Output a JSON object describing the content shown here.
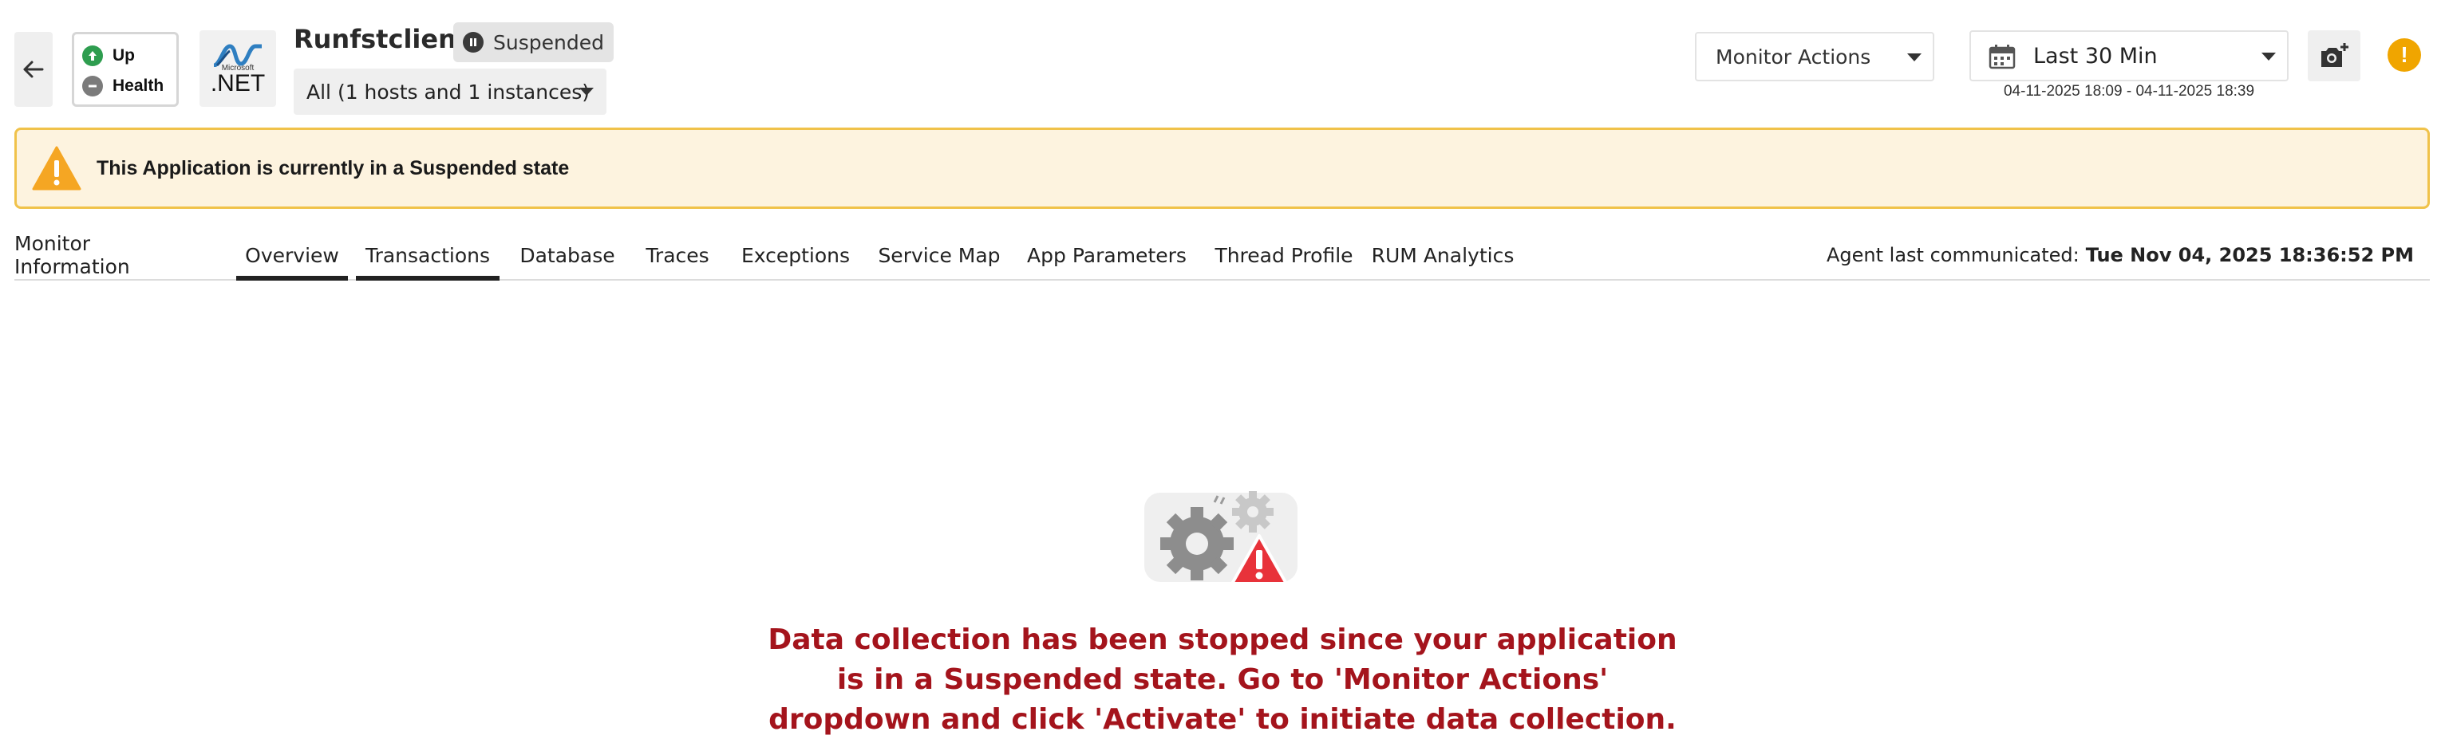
{
  "header": {
    "app_name": "Runfstclient",
    "status_badge": "Suspended",
    "host_filter": "All (1 hosts and 1 instances)",
    "status": {
      "availability_label": "Up",
      "health_label": "Health"
    },
    "logo": {
      "microsoft_text": "Microsoft",
      "net_text": ".NET"
    },
    "monitor_actions_label": "Monitor Actions",
    "time_filter": {
      "selected": "Last 30 Min",
      "range": "04-11-2025 18:09 - 04-11-2025 18:39"
    },
    "alert_symbol": "!"
  },
  "banner": {
    "message": "This Application is currently in a Suspended state"
  },
  "tabs": [
    {
      "label": "Monitor Information",
      "active": false
    },
    {
      "label": "Overview",
      "active": true
    },
    {
      "label": "Transactions",
      "active": true
    },
    {
      "label": "Database",
      "active": false
    },
    {
      "label": "Traces",
      "active": false
    },
    {
      "label": "Exceptions",
      "active": false
    },
    {
      "label": "Service Map",
      "active": false
    },
    {
      "label": "App Parameters",
      "active": false
    },
    {
      "label": "Thread Profile",
      "active": false
    },
    {
      "label": "RUM Analytics",
      "active": false
    }
  ],
  "agent": {
    "label": "Agent last communicated:",
    "value": "Tue Nov 04, 2025 18:36:52 PM"
  },
  "empty_state": {
    "message": "Data collection has been stopped since your application is in a Suspended state. Go to 'Monitor Actions' dropdown and click 'Activate' to initiate data collection."
  },
  "icons": {
    "back": "arrow-left-icon",
    "up": "arrow-up-icon",
    "health": "minus-icon",
    "pause": "pause-icon",
    "calendar": "calendar-icon",
    "camera": "camera-add-icon",
    "alert": "exclamation-icon",
    "warning": "warning-triangle-icon",
    "gears": "gears-warning-icon"
  },
  "colors": {
    "up_green": "#2e9d4f",
    "banner_bg": "#fdf3df",
    "banner_border": "#f0c24a",
    "warning_orange": "#f0a500",
    "error_red": "#a4141c"
  }
}
